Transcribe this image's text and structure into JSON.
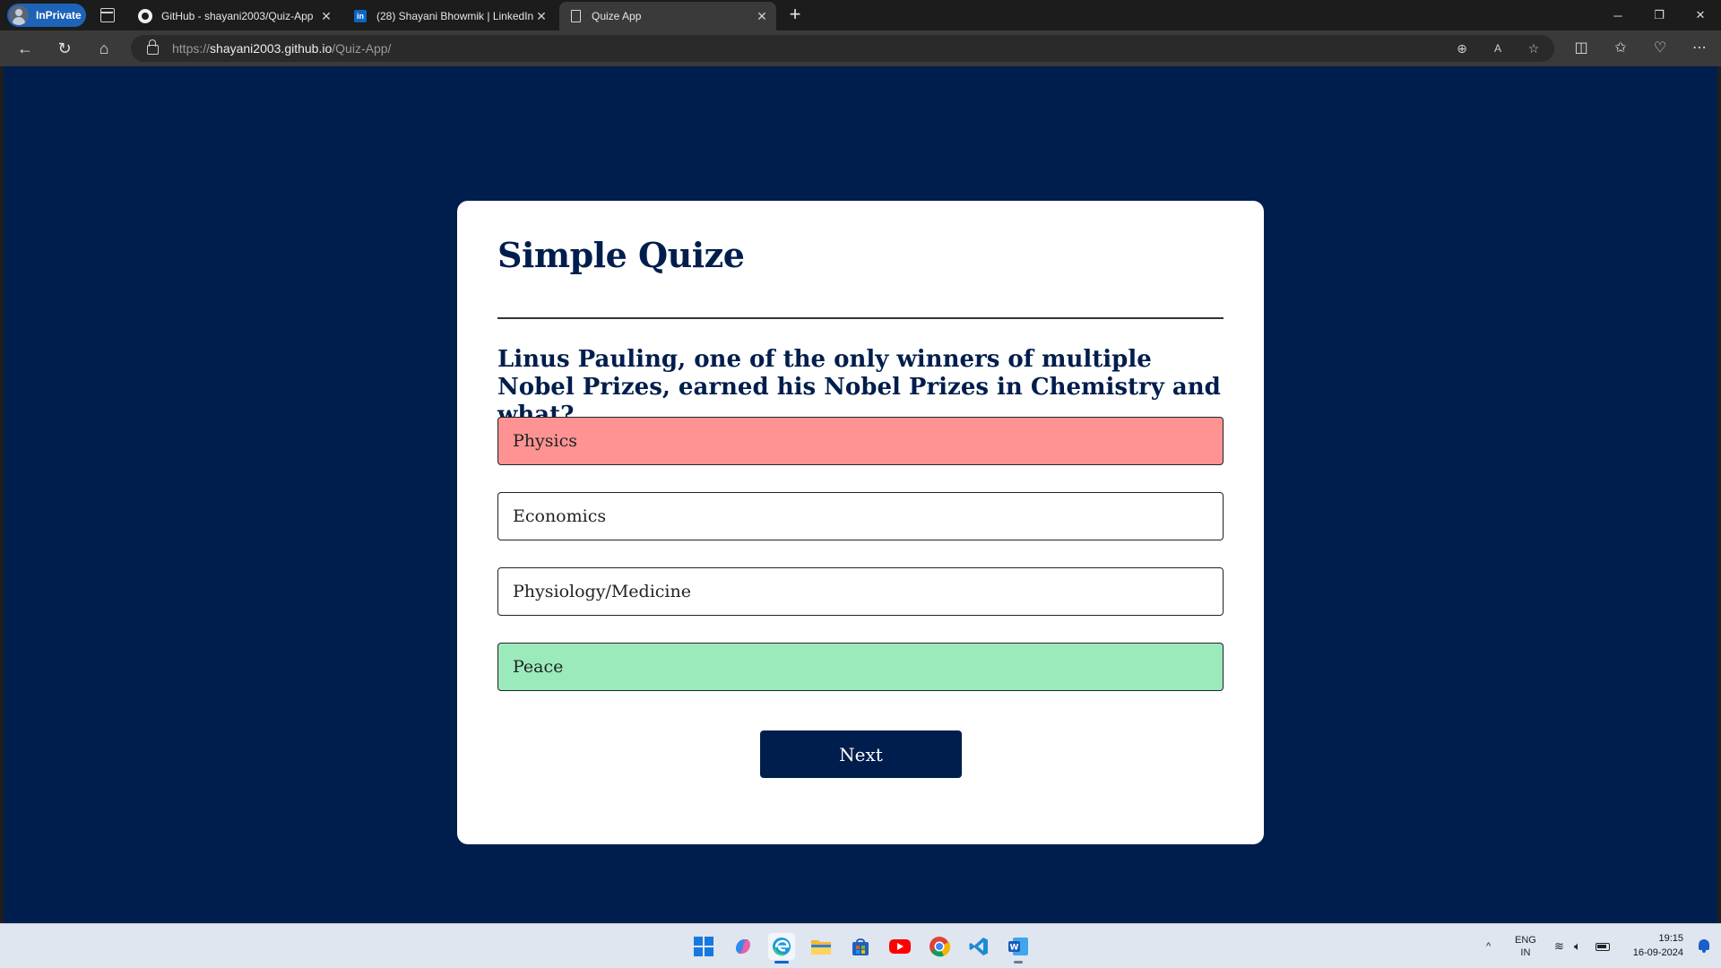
{
  "browser": {
    "inprivate_label": "InPrivate",
    "tabs": [
      {
        "title": "GitHub - shayani2003/Quiz-App",
        "icon": "github-icon"
      },
      {
        "title": "(28) Shayani Bhowmik | LinkedIn",
        "icon": "linkedin-icon",
        "icon_text": "in"
      },
      {
        "title": "Quize App",
        "icon": "page-icon"
      }
    ],
    "url_scheme": "https://",
    "url_host": "shayani2003.github.io",
    "url_path": "/Quiz-App/"
  },
  "quiz": {
    "title": "Simple Quize",
    "question": "Linus Pauling, one of the only winners of multiple Nobel Prizes, earned his Nobel Prizes in Chemistry and what?",
    "answers": [
      {
        "label": "Physics",
        "state": "wrong"
      },
      {
        "label": "Economics",
        "state": "neutral"
      },
      {
        "label": "Physiology/Medicine",
        "state": "neutral"
      },
      {
        "label": "Peace",
        "state": "correct"
      }
    ],
    "next_label": "Next"
  },
  "colors": {
    "page_background": "#001e4d",
    "card_background": "#ffffff",
    "wrong_answer": "#ff9393",
    "correct_answer": "#9aeabc",
    "button_background": "#001e4d"
  },
  "taskbar": {
    "language_top": "ENG",
    "language_bottom": "IN",
    "time": "19:15",
    "date": "16-09-2024"
  }
}
